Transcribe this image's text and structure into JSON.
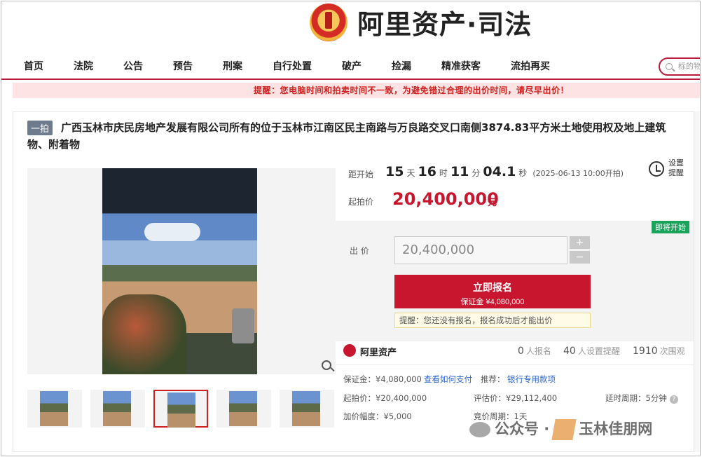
{
  "header": {
    "brand": "阿里资产·司法",
    "nav": [
      "首页",
      "法院",
      "公告",
      "预告",
      "刑案",
      "自行处置",
      "破产",
      "捡漏",
      "精准获客",
      "流拍再买"
    ],
    "search_placeholder": "标的物"
  },
  "warning": "提醒：您电脑时间和拍卖时间不一致，为避免错过合理的出价时间，请尽早出价！",
  "item": {
    "badge": "一拍",
    "title": "广西玉林市庆民房地产发展有限公司所有的位于玉林市江南区民主南路与万良路交叉口南侧3874.83平方米土地使用权及地上建筑物、附着物",
    "thumbs_count": 5,
    "selected_thumb": 2
  },
  "auction": {
    "countdown_label": "距开始",
    "days": "15",
    "days_unit": "天",
    "hours": "16",
    "hours_unit": "时",
    "minutes": "11",
    "minutes_unit": "分",
    "seconds": "04.1",
    "seconds_unit": "秒",
    "start_time": "(2025-06-13 10:00开拍)",
    "reminder_label": "设置提醒",
    "start_price_label": "起拍价",
    "start_price": "20,400,000",
    "currency": "元",
    "status_tag": "即将开始",
    "bid_label": "出 价",
    "bid_value": "20,400,000",
    "plus": "+",
    "minus": "−",
    "signup_label": "立即报名",
    "deposit_line": "保证金 ¥4,080,000",
    "hint": "提醒：您还没有报名，报名成功后才能出价"
  },
  "stats": {
    "org": "阿里资产",
    "signups": "0",
    "signups_label": "人报名",
    "reminders": "40",
    "reminders_label": "人设置提醒",
    "views": "1910",
    "views_label": "次围观"
  },
  "details": {
    "deposit": "保证金：¥4,080,000",
    "how_to_pay": "查看如何支付",
    "recommend_label": "推荐：",
    "recommend_link": "银行专用款项",
    "start_price": "起拍价：¥20,400,000",
    "appraisal": "评估价：¥29,112,400",
    "delay": "延时周期：5分钟",
    "increment": "加价幅度：¥5,000",
    "cycle": "竞价周期：1天"
  },
  "watermark": {
    "text1": "公众号 ·",
    "text2": "玉林佳朋网"
  }
}
